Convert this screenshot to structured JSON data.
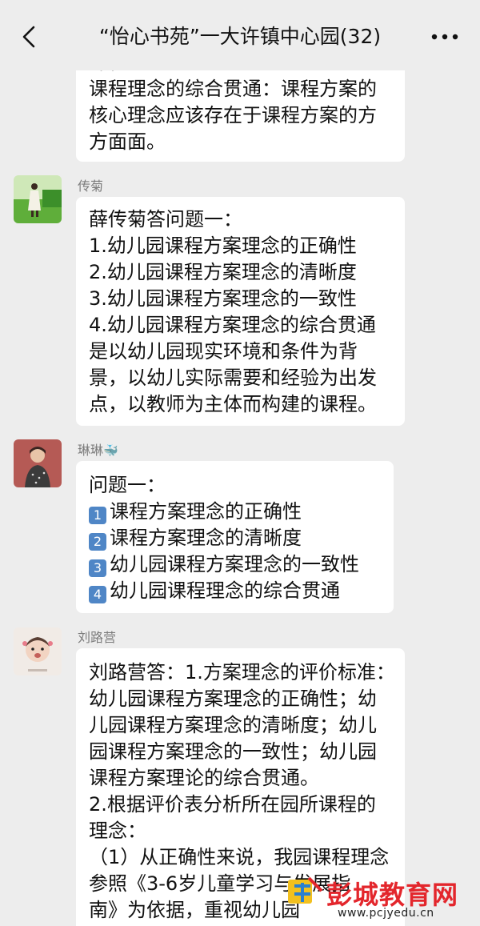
{
  "header": {
    "title": "“怡心书苑”一大许镇中心园(32)"
  },
  "messages": [
    {
      "lines": [
        "课程",
        "课程理念的综合贯通：课程方案的",
        "核心理念应该存在于课程方案的方",
        "方面面。"
      ]
    },
    {
      "sender": "传菊",
      "lines": [
        "薛传菊答问题一：",
        "1.幼儿园课程方案理念的正确性",
        "2.幼儿园课程方案理念的清晰度",
        "3.幼儿园课程方案理念的一致性",
        "4.幼儿园课程方案理念的综合贯通",
        "是以幼儿园现实环境和条件为背",
        "景，以幼儿实际需要和经验为出发",
        "点，以教师为主体而构建的课程。"
      ]
    },
    {
      "sender": "琳琳",
      "sender_emoji": "🐳",
      "heading": "问题一：",
      "items": [
        {
          "num": "1",
          "text": "课程方案理念的正确性"
        },
        {
          "num": "2",
          "text": "课程方案理念的清晰度"
        },
        {
          "num": "3",
          "text": "幼儿园课程方案理念的一致性"
        },
        {
          "num": "4",
          "text": "幼儿园课程理念的综合贯通"
        }
      ]
    },
    {
      "sender": "刘路营",
      "lines": [
        "刘路营答：1.方案理念的评价标准：",
        "幼儿园课程方案理念的正确性；幼",
        "儿园课程方案理念的清晰度；幼儿",
        "园课程方案理念的一致性；幼儿园",
        "课程方案理论的综合贯通。",
        "2.根据评价表分析所在园所课程的",
        "理念：",
        "（1）从正确性来说，我园课程理念",
        "参照《3-6岁儿童学习与发展指",
        "南》为依据，重视幼儿园"
      ]
    }
  ],
  "watermark": {
    "text": "彭城教育网",
    "url": "www.pcjyedu.cn"
  }
}
